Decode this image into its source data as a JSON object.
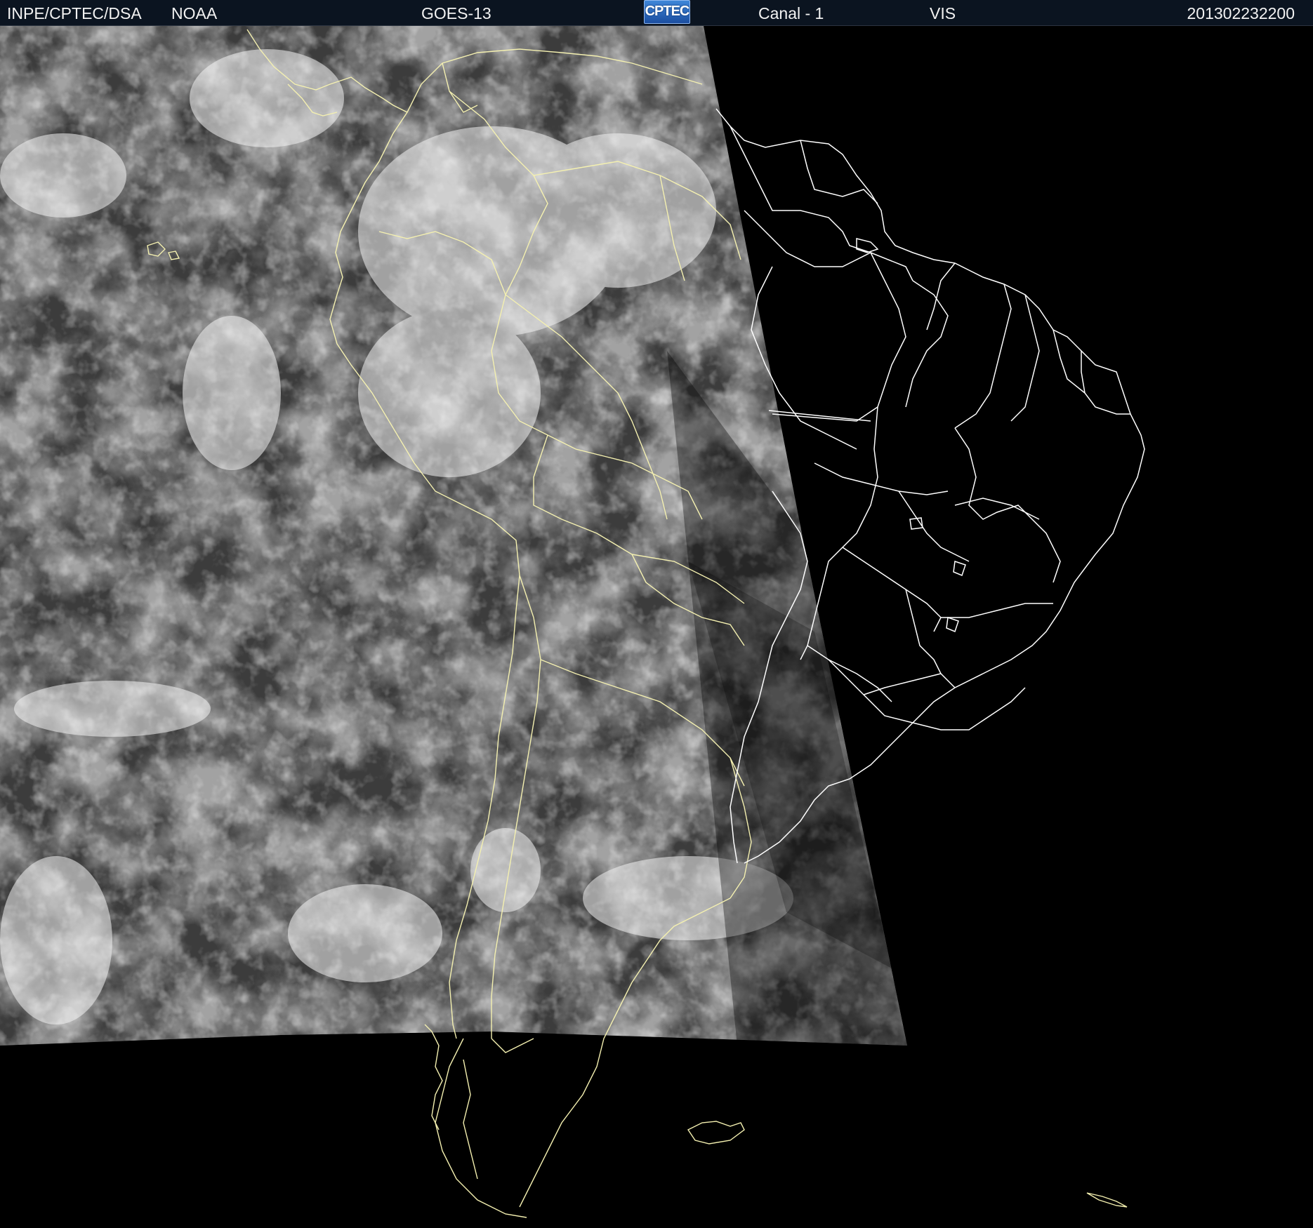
{
  "header": {
    "organization": "INPE/CPTEC/DSA",
    "agency": "NOAA",
    "satellite": "GOES-13",
    "logo_text": "CPTEC",
    "channel": "Canal - 1",
    "band": "VIS",
    "timestamp": "201302232200"
  },
  "colors": {
    "background": "#000000",
    "header_bg": "#0b1420",
    "header_text": "#f2f2f2",
    "boundary_lines": "#f4f0b0",
    "brazil_boundary_lines": "#ffffff",
    "logo_blue": "#2f6fc6"
  },
  "map": {
    "projection_view": "South America, satellite visible imagery",
    "icons": [
      "cptec-logo"
    ]
  }
}
